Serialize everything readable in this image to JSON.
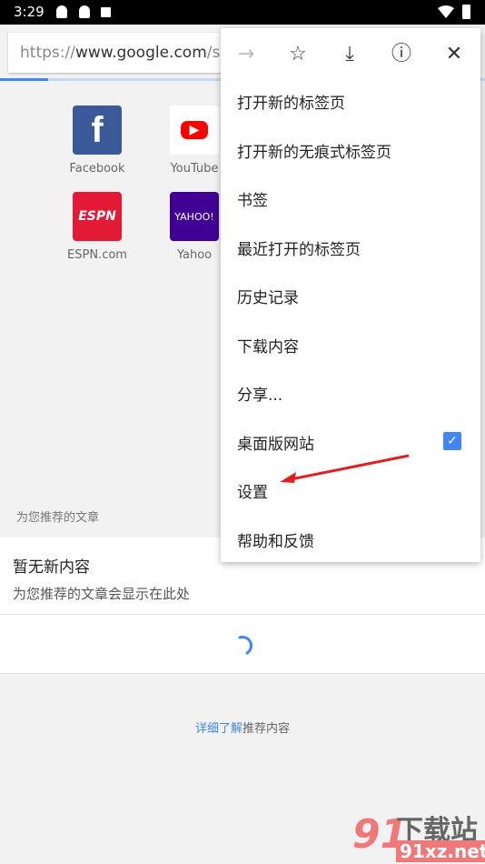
{
  "status": {
    "time": "3:29",
    "icons": [
      "qq-icon",
      "qq-icon",
      "a-icon",
      "wifi-icon",
      "battery-charging-icon"
    ]
  },
  "omnibox": {
    "scheme": "https://",
    "host": "www.google.com",
    "path": "/se"
  },
  "tiles": [
    {
      "label": "Facebook",
      "color": "#3b5998",
      "glyph": "f"
    },
    {
      "label": "YouTube",
      "color": "#ff0000",
      "glyph": "▶"
    },
    {
      "label": "ESPN.com",
      "color": "#e21a36",
      "glyph": "ESPN"
    },
    {
      "label": "Yahoo",
      "color": "#410093",
      "glyph": "YAHOO!"
    }
  ],
  "articles": {
    "section_label": "为您推荐的文章",
    "title": "暂无新内容",
    "subtitle": "为您推荐的文章会显示在此处",
    "learn_link": "详细了解",
    "learn_rest": "推荐内容"
  },
  "menu": {
    "toolbar": [
      "forward-icon",
      "star-icon",
      "download-icon",
      "info-icon",
      "close-icon"
    ],
    "items": [
      "打开新的标签页",
      "打开新的无痕式标签页",
      "书签",
      "最近打开的标签页",
      "历史记录",
      "下载内容",
      "分享...",
      "桌面版网站",
      "设置",
      "帮助和反馈"
    ],
    "desktop_site_checked": true
  },
  "watermark": {
    "text1": "下载站",
    "text2": "91xz.net"
  },
  "colors": {
    "accent": "#4285f4",
    "arrow": "#e02020"
  }
}
